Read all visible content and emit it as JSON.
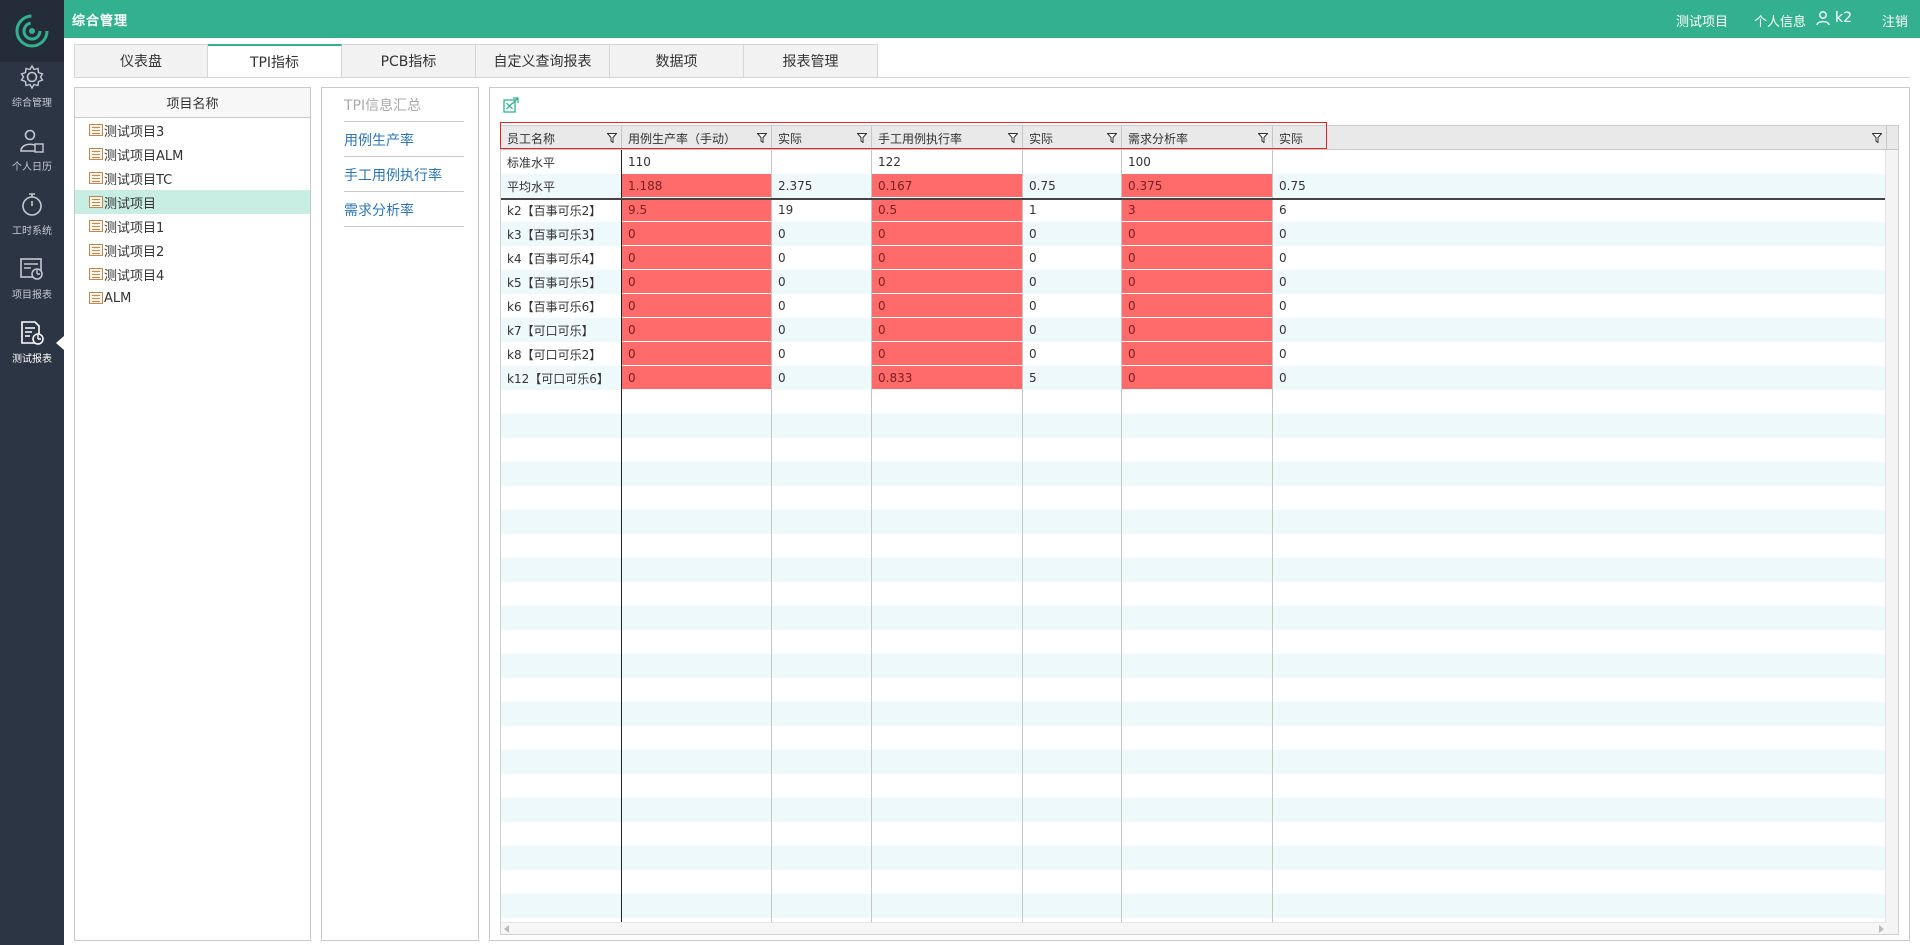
{
  "app_title": "综合管理",
  "topbar": {
    "project_link": "测试项目",
    "personal_info": "个人信息",
    "username": "k2",
    "logout": "注销"
  },
  "sidebar": [
    {
      "label": "综合管理",
      "icon": "gear-icon"
    },
    {
      "label": "个人日历",
      "icon": "user-calendar-icon"
    },
    {
      "label": "工时系统",
      "icon": "stopwatch-icon"
    },
    {
      "label": "项目报表",
      "icon": "project-report-icon"
    },
    {
      "label": "测试报表",
      "icon": "test-report-icon",
      "active": true
    }
  ],
  "tabs": [
    {
      "label": "仪表盘"
    },
    {
      "label": "TPI指标",
      "active": true
    },
    {
      "label": "PCB指标"
    },
    {
      "label": "自定义查询报表"
    },
    {
      "label": "数据项"
    },
    {
      "label": "报表管理"
    }
  ],
  "project_panel": {
    "header": "项目名称",
    "items": [
      "测试项目3",
      "测试项目ALM",
      "测试项目TC",
      "测试项目",
      "测试项目1",
      "测试项目2",
      "测试项目4",
      "ALM"
    ],
    "selected": "测试项目"
  },
  "tpi_menu": {
    "title": "TPI信息汇总",
    "items": [
      "用例生产率",
      "手工用例执行率",
      "需求分析率"
    ]
  },
  "grid": {
    "columns": [
      "员工名称",
      "用例生产率（手动）",
      "实际",
      "手工用例执行率",
      "实际",
      "需求分析率",
      "实际"
    ],
    "standard_row": [
      "标准水平",
      "110",
      "",
      "122",
      "",
      "100",
      ""
    ],
    "average_row": [
      "平均水平",
      "1.188",
      "2.375",
      "0.167",
      "0.75",
      "0.375",
      "0.75"
    ],
    "rows": [
      [
        "k2【百事可乐2】",
        "9.5",
        "19",
        "0.5",
        "1",
        "3",
        "6"
      ],
      [
        "k3【百事可乐3】",
        "0",
        "0",
        "0",
        "0",
        "0",
        "0"
      ],
      [
        "k4【百事可乐4】",
        "0",
        "0",
        "0",
        "0",
        "0",
        "0"
      ],
      [
        "k5【百事可乐5】",
        "0",
        "0",
        "0",
        "0",
        "0",
        "0"
      ],
      [
        "k6【百事可乐6】",
        "0",
        "0",
        "0",
        "0",
        "0",
        "0"
      ],
      [
        "k7【可口可乐】",
        "0",
        "0",
        "0",
        "0",
        "0",
        "0"
      ],
      [
        "k8【可口可乐2】",
        "0",
        "0",
        "0",
        "0",
        "0",
        "0"
      ],
      [
        "k12【可口可乐6】",
        "0",
        "0",
        "0.833",
        "5",
        "0",
        "0"
      ]
    ],
    "highlight_color": "#ff6a6a"
  },
  "colors": {
    "brand_green": "#33b18e",
    "sidebar_dark": "#2b3544",
    "link_blue": "#2e75b6",
    "selected_row": "#c8ede2",
    "highlight_border": "#e3232c"
  }
}
